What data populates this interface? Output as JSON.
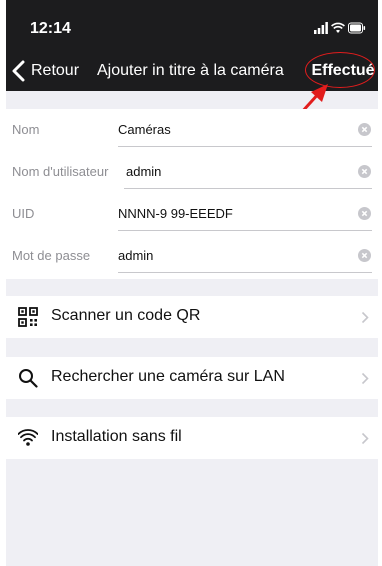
{
  "status_bar": {
    "time": "12:14"
  },
  "nav": {
    "back_label": "Retour",
    "title": "Ajouter in titre à la caméra",
    "done_label": "Effectué"
  },
  "form": {
    "fields": [
      {
        "label": "Nom",
        "value": "Caméras"
      },
      {
        "label": "Nom d'utilisateur",
        "value": "admin"
      },
      {
        "label": "UID",
        "value": "NNNN-9 99-EEEDF"
      },
      {
        "label": "Mot de passe",
        "value": "admin"
      }
    ]
  },
  "actions": [
    {
      "label": "Scanner un code QR",
      "icon": "qr-code-icon"
    },
    {
      "label": "Rechercher une caméra sur LAN",
      "icon": "search-icon"
    },
    {
      "label": "Installation sans fil",
      "icon": "wifi-icon"
    }
  ],
  "colors": {
    "nav_background": "#1c1c1e",
    "page_background": "#efeff4",
    "annotation": "#e21d1d"
  }
}
